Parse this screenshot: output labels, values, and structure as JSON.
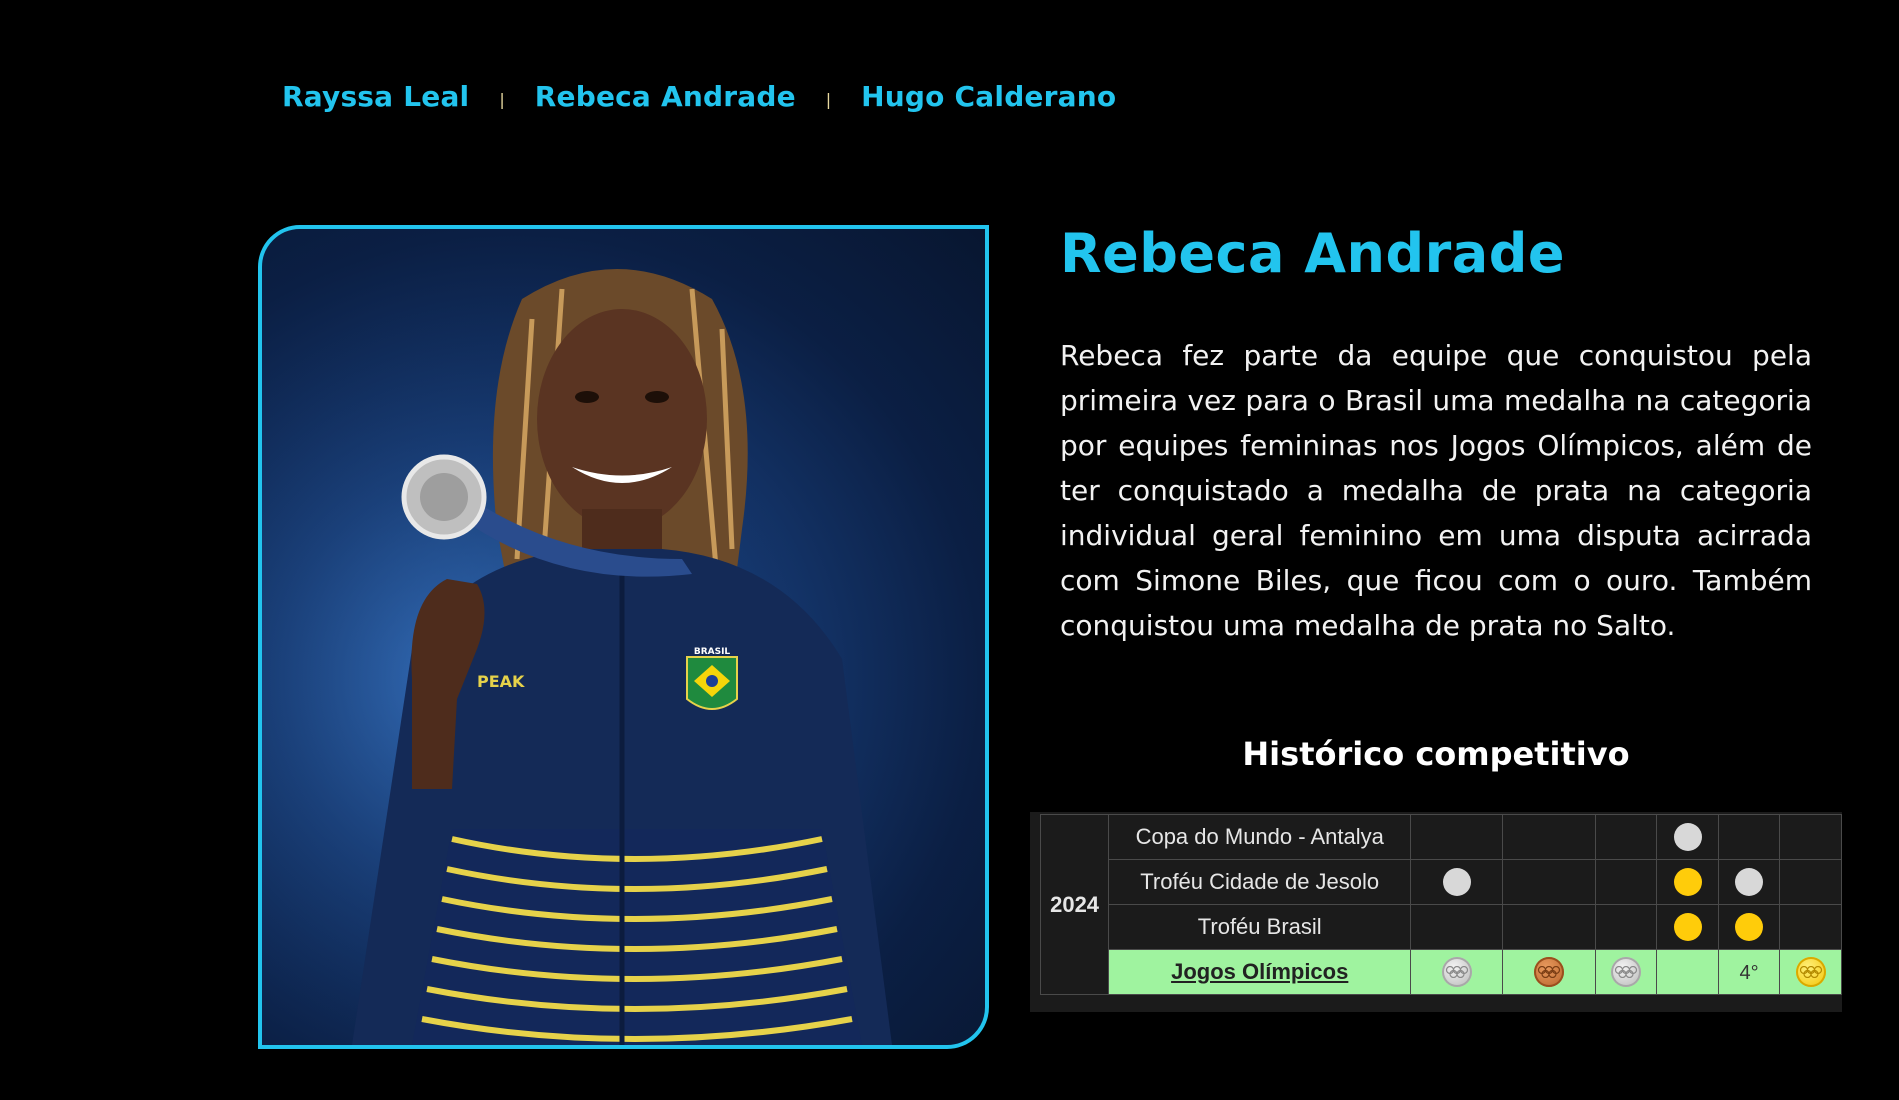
{
  "nav": {
    "items": [
      {
        "label": "Rayssa Leal"
      },
      {
        "label": "Rebeca Andrade"
      },
      {
        "label": "Hugo Calderano"
      }
    ],
    "separator": "|"
  },
  "athlete": {
    "name": "Rebeca Andrade",
    "bio": "Rebeca fez parte da equipe que conquistou pela primeira vez para o Brasil uma medalha na categoria por equipes femininas nos Jogos Olímpicos, além de ter conquistado a medalha de prata na categoria individual geral feminino em uma disputa acirrada com Simone Biles, que ficou com o ouro. Também conquistou uma medalha de prata no Salto.",
    "photo": {
      "jacket_text": "BRASIL",
      "brand_text": "PEAK"
    }
  },
  "history": {
    "title": "Histórico competitivo",
    "year": "2024",
    "rows": [
      {
        "event": "Copa do Mundo - Antalya",
        "cells": [
          "",
          "",
          "",
          "silver-dot",
          "",
          ""
        ]
      },
      {
        "event": "Troféu Cidade de Jesolo",
        "cells": [
          "silver-dot",
          "",
          "",
          "gold-dot",
          "silver-dot",
          ""
        ]
      },
      {
        "event": "Troféu Brasil",
        "cells": [
          "",
          "",
          "",
          "gold-dot",
          "gold-dot",
          ""
        ]
      },
      {
        "event": "Jogos Olímpicos",
        "highlight": true,
        "cells": [
          "silver-medal",
          "bronze-medal",
          "silver-medal",
          "",
          "4°",
          "gold-medal"
        ]
      }
    ]
  },
  "colors": {
    "accent": "#22c4ee",
    "background": "#000000",
    "olympic_row": "#9ff39f",
    "gold": "#ffcc0a",
    "silver": "#d8d8d8",
    "bronze": "#c06a30"
  }
}
